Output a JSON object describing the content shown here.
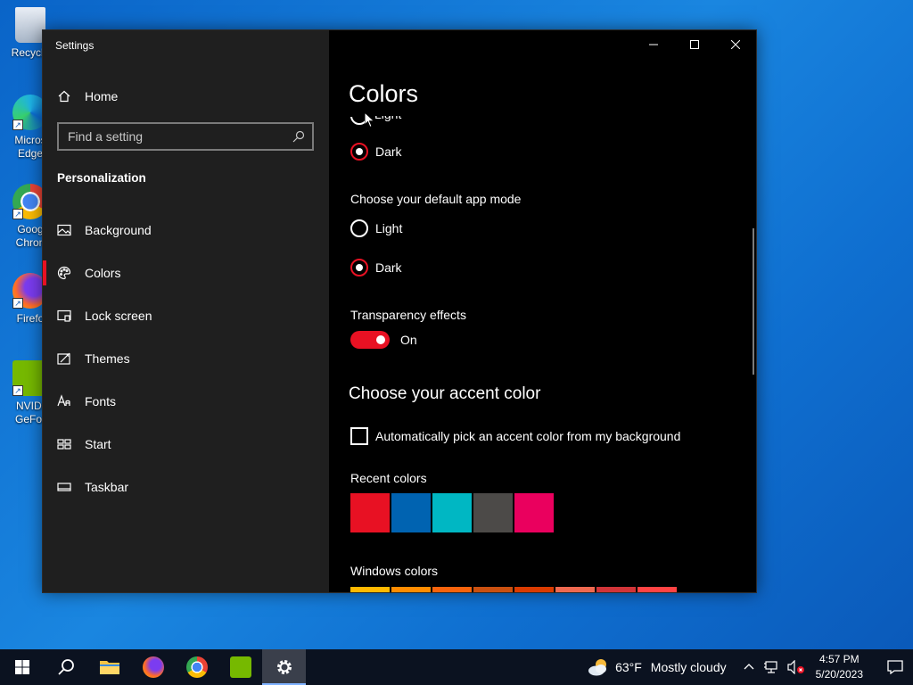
{
  "desktop": {
    "icons": [
      {
        "label": "Recycle",
        "icon": "recycle-bin-icon"
      },
      {
        "label": "Micros\nEdge",
        "icon": "edge-icon"
      },
      {
        "label": "Goog\nChron",
        "icon": "chrome-icon"
      },
      {
        "label": "Firefo",
        "icon": "firefox-icon"
      },
      {
        "label": "NVIDI\nGeFor",
        "icon": "nvidia-icon"
      }
    ]
  },
  "window": {
    "title": "Settings",
    "controls": {
      "minimize": "minimize-icon",
      "maximize": "maximize-icon",
      "close": "close-icon"
    }
  },
  "sidebar": {
    "home_label": "Home",
    "search_placeholder": "Find a setting",
    "section": "Personalization",
    "items": [
      {
        "label": "Background",
        "icon": "picture-icon"
      },
      {
        "label": "Colors",
        "icon": "palette-icon",
        "active": true
      },
      {
        "label": "Lock screen",
        "icon": "lock-screen-icon"
      },
      {
        "label": "Themes",
        "icon": "themes-icon"
      },
      {
        "label": "Fonts",
        "icon": "fonts-icon"
      },
      {
        "label": "Start",
        "icon": "start-icon"
      },
      {
        "label": "Taskbar",
        "icon": "taskbar-icon"
      }
    ]
  },
  "content": {
    "title": "Colors",
    "windows_mode": {
      "partial_option": "Light",
      "selected_option": "Dark"
    },
    "app_mode": {
      "heading": "Choose your default app mode",
      "options": [
        "Light",
        "Dark"
      ],
      "selected": "Dark"
    },
    "transparency": {
      "heading": "Transparency effects",
      "state_label": "On"
    },
    "accent": {
      "heading": "Choose your accent color",
      "auto_pick_label": "Automatically pick an accent color from my background",
      "recent_label": "Recent colors",
      "recent_colors": [
        "#e81123",
        "#0063b1",
        "#00b7c3",
        "#4c4a48",
        "#ea005e"
      ],
      "windows_label": "Windows colors",
      "windows_colors": [
        "#ffb900",
        "#ff8c00",
        "#f7630c",
        "#ca5010",
        "#da3b01",
        "#ef6950",
        "#d13438",
        "#ff4343"
      ]
    },
    "accent_color": "#e81123"
  },
  "taskbar": {
    "weather": {
      "temp": "63°F",
      "condition": "Mostly cloudy"
    },
    "time": "4:57 PM",
    "date": "5/20/2023"
  }
}
